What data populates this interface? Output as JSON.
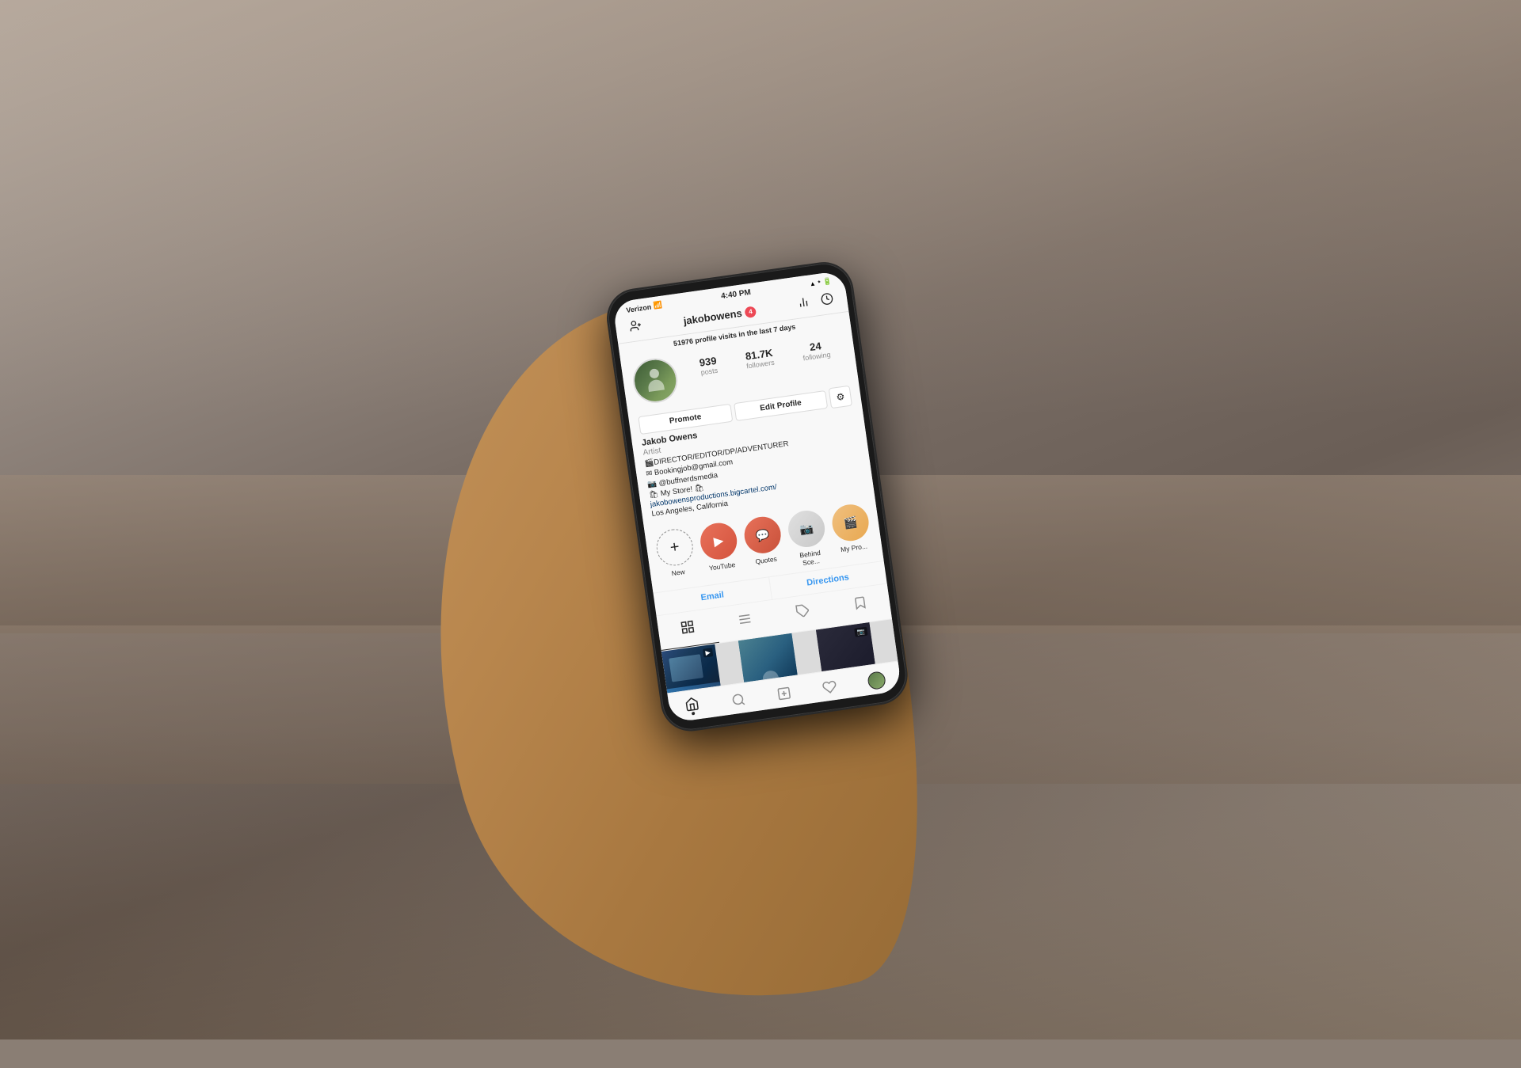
{
  "background": {
    "color": "#8a7e74"
  },
  "status_bar": {
    "carrier": "Verizon",
    "wifi": "📶",
    "time": "4:40 PM",
    "battery_icon": "🔋",
    "signal": "📶"
  },
  "instagram": {
    "nav": {
      "add_icon": "+👤",
      "username": "jakobowens",
      "notification_count": "4",
      "stats_icon": "📊",
      "clock_icon": "🕐"
    },
    "profile_visits": {
      "count": "51976",
      "text": "profile visits in the last 7 days"
    },
    "stats": {
      "posts": {
        "value": "939",
        "label": "posts"
      },
      "followers": {
        "value": "81.7K",
        "label": "followers"
      },
      "following": {
        "value": "24",
        "label": "following"
      }
    },
    "buttons": {
      "promote": "Promote",
      "edit_profile": "Edit Profile",
      "settings": "⚙"
    },
    "bio": {
      "name": "Jakob Owens",
      "category": "Artist",
      "line1": "🎬DIRECTOR/EDITOR/DP/ADVENTURER",
      "line2": "✉ Bookingjob@gmail.com",
      "line3": "📷 @buffnerdsmedia",
      "line4": "🛍 My Store! 🛍",
      "website": "jakobowensproductions.bigcartel.com/",
      "location": "Los Angeles, California"
    },
    "highlights": [
      {
        "id": "new",
        "label": "New",
        "icon": "+",
        "type": "add"
      },
      {
        "id": "youtube",
        "label": "YouTube",
        "icon": "▶",
        "type": "youtube"
      },
      {
        "id": "quotes",
        "label": "Quotes",
        "icon": "💬",
        "type": "quotes"
      },
      {
        "id": "behind",
        "label": "Behind Sce...",
        "icon": "📷",
        "type": "behind"
      },
      {
        "id": "mypro",
        "label": "My Pro...",
        "icon": "🎬",
        "type": "mypro"
      }
    ],
    "contact": {
      "email": "Email",
      "directions": "Directions"
    },
    "grid_tabs": [
      {
        "id": "grid",
        "icon": "⊞",
        "active": true
      },
      {
        "id": "list",
        "icon": "☰",
        "active": false
      },
      {
        "id": "tagged",
        "icon": "👤",
        "active": false
      },
      {
        "id": "saved",
        "icon": "🔖",
        "active": false
      }
    ],
    "bottom_nav": [
      {
        "id": "home",
        "icon": "🏠",
        "active": true
      },
      {
        "id": "search",
        "icon": "🔍",
        "active": false
      },
      {
        "id": "add",
        "icon": "➕",
        "active": false
      },
      {
        "id": "heart",
        "icon": "🤍",
        "active": false
      },
      {
        "id": "profile",
        "icon": "👤",
        "active": false
      }
    ]
  }
}
